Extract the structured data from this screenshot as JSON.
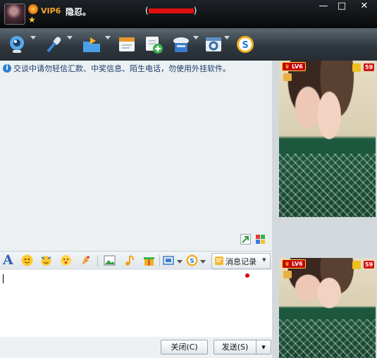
{
  "user": {
    "vip": "VIP6",
    "nickname": "隐忍。",
    "qq_number_prefix": "(",
    "qq_number_suffix": ")"
  },
  "window_buttons": [
    "—",
    "□",
    "✕"
  ],
  "toolbar": {
    "items": [
      {
        "icon": "webcam-icon",
        "color": "#4ea2e0"
      },
      {
        "icon": "microphone-icon",
        "color": "#3a8ad8"
      },
      {
        "icon": "send-file-icon",
        "color": "#4aa0e8"
      },
      {
        "icon": "send-email-icon",
        "color": "#e49a30"
      },
      {
        "icon": "create-group-icon",
        "color": "#3cb04a"
      },
      {
        "icon": "remote-assist-icon",
        "color": "#3a7ccc"
      },
      {
        "icon": "app-settings-icon",
        "color": "#5f8fc4"
      },
      {
        "icon": "soso-icon",
        "color": "#f0b020"
      }
    ]
  },
  "notice": "交谈中请勿轻信汇款、中奖信息、陌生电话，勿使用外挂软件。",
  "format_bar": {
    "font_label": "A",
    "history_label": "消息记录",
    "history_arrow": "▾"
  },
  "buttons": {
    "close": "关闭(C)",
    "send": "发送(S)",
    "send_dropdown": "▾"
  },
  "sidebar": {
    "top_video": {
      "level": "LV6",
      "count": "59"
    },
    "bottom_video": {
      "level": "LV6",
      "count": "59"
    }
  }
}
